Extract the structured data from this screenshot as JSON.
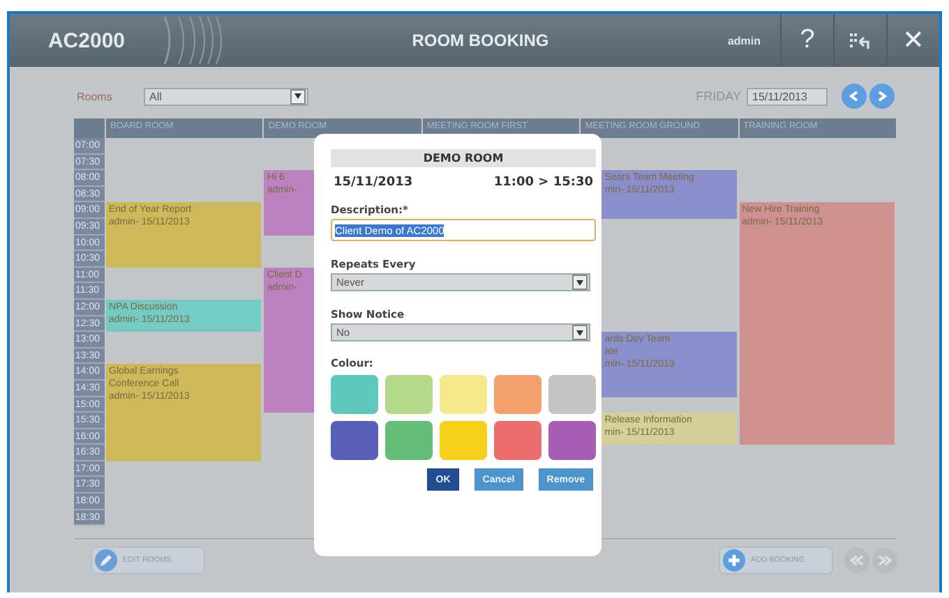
{
  "header": {
    "logo": "AC2000",
    "title": "ROOM BOOKING",
    "user": "admin",
    "help": "?",
    "close": "✕"
  },
  "toolbar": {
    "rooms_label": "Rooms",
    "rooms_value": "All",
    "day": "FRIDAY",
    "date": "15/11/2013"
  },
  "times": [
    "07:00",
    "07:30",
    "08:00",
    "08:30",
    "09:00",
    "09:30",
    "10:00",
    "10:30",
    "11:00",
    "11:30",
    "12:00",
    "12:30",
    "13:00",
    "13:30",
    "14:00",
    "14:30",
    "15:00",
    "15:30",
    "16:00",
    "16:30",
    "17:00",
    "17:30",
    "18:00",
    "18:30"
  ],
  "rooms": [
    {
      "name": "BOARD ROOM",
      "slots": [
        {
          "kind": "free"
        },
        {
          "kind": "free"
        },
        {
          "kind": "free"
        },
        {
          "kind": "free"
        },
        {
          "kind": "booking",
          "color": "#cdb95a",
          "lines": [
            "End of Year Report",
            "admin- 15/11/2013"
          ]
        },
        {
          "kind": "continued"
        },
        {
          "kind": "continued"
        },
        {
          "kind": "continued"
        },
        {
          "kind": "free"
        },
        {
          "kind": "free"
        },
        {
          "kind": "booking",
          "color": "#74cbc3",
          "lines": [
            "NPA Discussion",
            "admin- 15/11/2013"
          ]
        },
        {
          "kind": "continued"
        },
        {
          "kind": "free"
        },
        {
          "kind": "free"
        },
        {
          "kind": "booking",
          "color": "#cdb95a",
          "lines": [
            "Global Earnings",
            "Conference Call",
            "admin- 15/11/2013"
          ]
        },
        {
          "kind": "continued"
        },
        {
          "kind": "continued"
        },
        {
          "kind": "continued"
        },
        {
          "kind": "continued"
        },
        {
          "kind": "continued"
        },
        {
          "kind": "free"
        },
        {
          "kind": "free"
        },
        {
          "kind": "free"
        },
        {
          "kind": "free"
        }
      ]
    },
    {
      "name": "DEMO ROOM",
      "slots": [
        {
          "kind": "free"
        },
        {
          "kind": "free"
        },
        {
          "kind": "booking",
          "color": "#bb82bf",
          "lines": [
            "Hi 6",
            "admin-"
          ]
        },
        {
          "kind": "continued"
        },
        {
          "kind": "continued"
        },
        {
          "kind": "continued"
        },
        {
          "kind": "free"
        },
        {
          "kind": "free"
        },
        {
          "kind": "booking",
          "color": "#bb82bf",
          "lines": [
            "Client D",
            "admin-"
          ]
        },
        {
          "kind": "continued"
        },
        {
          "kind": "continued"
        },
        {
          "kind": "continued"
        },
        {
          "kind": "continued"
        },
        {
          "kind": "continued"
        },
        {
          "kind": "continued"
        },
        {
          "kind": "continued"
        },
        {
          "kind": "continued"
        },
        {
          "kind": "free"
        },
        {
          "kind": "free"
        },
        {
          "kind": "free"
        },
        {
          "kind": "free"
        },
        {
          "kind": "free"
        },
        {
          "kind": "free"
        },
        {
          "kind": "free"
        }
      ]
    },
    {
      "name": "MEETING ROOM FIRST"
    },
    {
      "name": "MEETING ROOM GROUND",
      "slots": [
        {
          "kind": "free"
        },
        {
          "kind": "free"
        },
        {
          "kind": "booking",
          "color": "#8a8fcc",
          "lines": [
            "Sears Team Meeting",
            "min- 15/11/2013"
          ]
        },
        {
          "kind": "continued"
        },
        {
          "kind": "continued"
        },
        {
          "kind": "free"
        },
        {
          "kind": "free"
        },
        {
          "kind": "free"
        },
        {
          "kind": "free"
        },
        {
          "kind": "free"
        },
        {
          "kind": "free"
        },
        {
          "kind": "free"
        },
        {
          "kind": "booking",
          "color": "#8a8fcc",
          "lines": [
            "ards Dev Team",
            "ate",
            "min- 15/11/2013"
          ]
        },
        {
          "kind": "continued"
        },
        {
          "kind": "continued"
        },
        {
          "kind": "continued"
        },
        {
          "kind": "free"
        },
        {
          "kind": "booking",
          "color": "#d6cf9a",
          "lines": [
            "Release Information",
            "min- 15/11/2013"
          ]
        },
        {
          "kind": "continued"
        },
        {
          "kind": "free"
        },
        {
          "kind": "free"
        },
        {
          "kind": "free"
        },
        {
          "kind": "free"
        },
        {
          "kind": "free"
        }
      ]
    },
    {
      "name": "TRAINING ROOM",
      "slots": [
        {
          "kind": "free"
        },
        {
          "kind": "free"
        },
        {
          "kind": "free"
        },
        {
          "kind": "free"
        },
        {
          "kind": "booking",
          "color": "#cf9090",
          "lines": [
            "New Hire Training",
            "admin- 15/11/2013"
          ]
        },
        {
          "kind": "continued"
        },
        {
          "kind": "continued"
        },
        {
          "kind": "continued"
        },
        {
          "kind": "continued"
        },
        {
          "kind": "continued"
        },
        {
          "kind": "continued"
        },
        {
          "kind": "continued"
        },
        {
          "kind": "continued"
        },
        {
          "kind": "continued"
        },
        {
          "kind": "continued"
        },
        {
          "kind": "continued"
        },
        {
          "kind": "continued"
        },
        {
          "kind": "continued"
        },
        {
          "kind": "continued"
        },
        {
          "kind": "free"
        },
        {
          "kind": "free"
        },
        {
          "kind": "free"
        },
        {
          "kind": "free"
        },
        {
          "kind": "free"
        }
      ]
    }
  ],
  "dialog": {
    "title": "DEMO ROOM",
    "date": "15/11/2013",
    "time": "11:00 > 15:30",
    "description_label": "Description:*",
    "description": "Client Demo of AC2000",
    "repeats_label": "Repeats Every",
    "repeats": "Never",
    "notice_label": "Show Notice",
    "notice": "No",
    "colour_label": "Colour:",
    "colours": [
      {
        "color": "#5ec8bd",
        "selected": false
      },
      {
        "color": "#b5d98a",
        "selected": false
      },
      {
        "color": "#f5e88a",
        "selected": false
      },
      {
        "color": "#f3a06e",
        "selected": false
      },
      {
        "color": "#c4c4c4",
        "selected": false
      },
      {
        "color": "#5a5fb8",
        "selected": false
      },
      {
        "color": "#66bd78",
        "selected": false
      },
      {
        "color": "#f7d21a",
        "selected": false
      },
      {
        "color": "#ec6d6d",
        "selected": false
      },
      {
        "color": "#a55eb3",
        "selected": false
      }
    ],
    "buttons": [
      {
        "label": "OK",
        "kind": "primary"
      },
      {
        "label": "Cancel",
        "kind": "secondary"
      },
      {
        "label": "Remove",
        "kind": "secondary"
      }
    ]
  },
  "footer": {
    "edit": "EDIT ROOMS",
    "add": "ADD BOOKING"
  }
}
